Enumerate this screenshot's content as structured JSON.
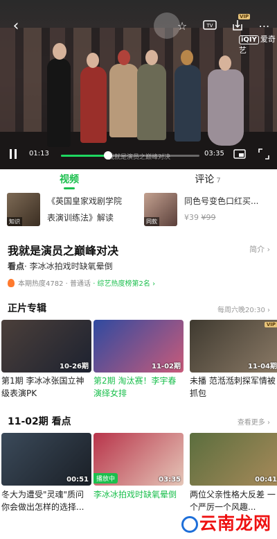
{
  "player": {
    "current_time": "01:13",
    "total_time": "03:35",
    "progress_fraction": 0.34,
    "subtitle": "我就是演员之巅峰对决",
    "brand": "爱奇艺",
    "brand_logo": "iQIY",
    "vip_label": "VIP"
  },
  "tabs": [
    {
      "label": "视频",
      "active": true
    },
    {
      "label": "评论",
      "count": "7",
      "active": false
    }
  ],
  "promos": [
    {
      "tag": "知识",
      "text_line1": "《英国皇家戏剧学院",
      "text_line2": "表演训练法》解读"
    },
    {
      "tag": "同款",
      "text_line1": "同色号变色口红买...",
      "price": "¥39",
      "old_price": "¥99"
    }
  ],
  "show": {
    "title": "我就是演员之巅峰对决",
    "intro_label": "简介",
    "highlight_prefix": "看点",
    "highlight_text": "· 李冰冰拍戏时缺氧晕倒",
    "heat": "本期热度4782",
    "level": "· 普通话",
    "rank": "· 综艺热度榜第2名"
  },
  "episodes_section": {
    "title": "正片专辑",
    "schedule": "每周六晚20:30",
    "cards": [
      {
        "badge": "10-26期",
        "caption": "第1期 李冰冰张国立神级表演PK",
        "highlighted": false
      },
      {
        "badge": "11-02期",
        "caption": "第2期 淘汰赛！李宇春演绎女排",
        "highlighted": true
      },
      {
        "badge": "11-04期",
        "caption": "未播 范湉湉刺探军情被抓包",
        "highlighted": false,
        "vip": "VIP"
      }
    ]
  },
  "highlights_section": {
    "title": "11-02期 看点",
    "more": "查看更多",
    "cards": [
      {
        "badge": "00:51",
        "caption": "冬大为遭受\"灵魂\"质问你会做出怎样的选择...",
        "highlighted": false
      },
      {
        "badge": "03:35",
        "caption": "李冰冰拍戏时缺氧晕倒",
        "highlighted": true,
        "playing": "播放中"
      },
      {
        "badge": "00:41",
        "caption": "两位父亲性格大反差 一个严厉一个风趣...",
        "highlighted": false
      }
    ]
  },
  "watermark": "云南龙网",
  "colors": {
    "accent": "#1bbf4d",
    "vip_gold": "#e6c37a"
  }
}
